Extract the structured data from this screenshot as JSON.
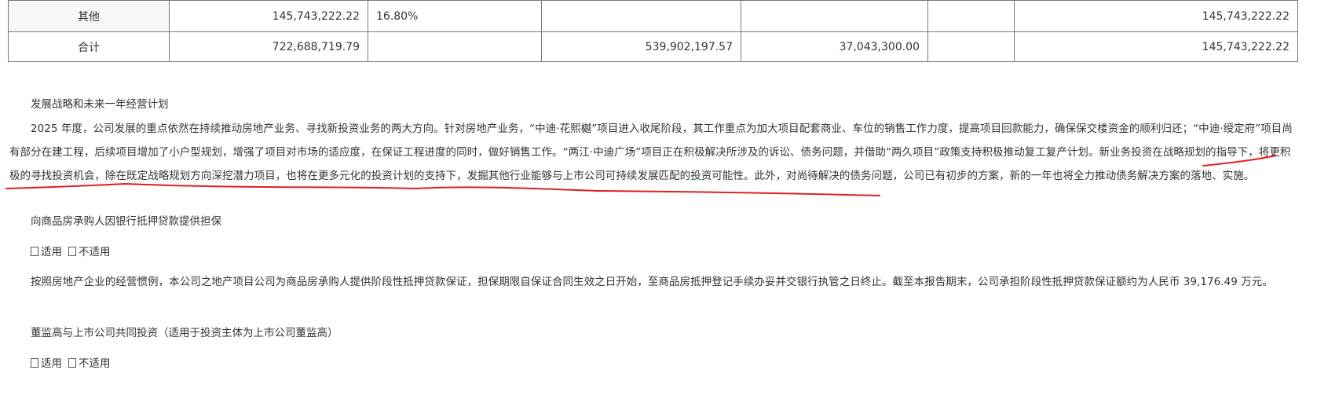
{
  "table": {
    "rows": [
      {
        "name": "其他",
        "c1": "145,743,222.22",
        "c2": "16.80%",
        "c3": "",
        "c4": "",
        "c5": "",
        "c6": "145,743,222.22"
      },
      {
        "name": "合计",
        "c1": "722,688,719.79",
        "c2": "",
        "c3": "539,902,197.57",
        "c4": "37,043,300.00",
        "c5": "",
        "c6": "145,743,222.22"
      }
    ]
  },
  "sections": {
    "strategy_title": "发展战略和未来一年经营计划",
    "strategy_p1": "2025 年度，公司发展的重点依然在持续推动房地产业务、寻找新投资业务的两大方向。针对房地产业务，“中迪·花熙樾”项目进入收尾阶段，其工作重点为加大项目配套商业、车位的销售工作力度，提高项目回款能力，确保保交楼资金的顺利归还；“中迪·绶定府”项目尚有部分在建工程，后续项目增加了小户型规划，增强了项目对市场的适应度，在保证工程进度的同时，做好销售工作。“两江·中迪广场”项目正在积极解决所涉及的诉讼、债务问题，并借助“两久项目”政策支持积极推动复工复产计划。",
    "strategy_p1_underlined": "新业务投资在战略规划的指导下，将更积极的寻找投资机会，除在既定战略规划方向深挖潜力项目，也将在更多元化的投资计划的支持下，发掘其他行业能够与上市公司可持续发展匹配的投资可能性。",
    "strategy_p1_tail": "此外，对尚待解决的债务问题，公司已有初步的方案，新的一年也将全力推动债务解决方案的落地、实施。",
    "mortgage_title": "向商品房承购人因银行抵押贷款提供担保",
    "mortgage_applicable": "适用",
    "mortgage_not_applicable": "不适用",
    "mortgage_text": "按照房地产企业的经营惯例，本公司之地产项目公司为商品房承购人提供阶段性抵押贷款保证，担保期限自保证合同生效之日开始，至商品房抵押登记手续办妥并交银行执管之日终止。截至本报告期末，公司承担阶段性抵押贷款保证额约为人民币 39,176.49 万元。",
    "coinvest_title": "董监高与上市公司共同投资（适用于投资主体为上市公司董监高）",
    "coinvest_applicable": "适用",
    "coinvest_not_applicable": "不适用"
  },
  "annotation_color": "#e02020"
}
